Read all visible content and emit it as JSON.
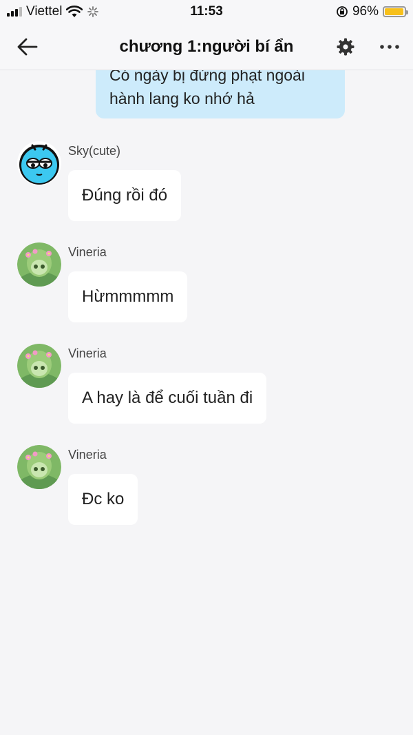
{
  "status_bar": {
    "carrier": "Viettel",
    "time": "11:53",
    "battery_percent": "96%",
    "battery_level": 0.96,
    "icons": [
      "signal-icon",
      "wifi-icon",
      "loading-icon",
      "orientation-lock-icon",
      "battery-icon"
    ]
  },
  "header": {
    "title": "chương 1:người bí ẩn",
    "icons": [
      "back-arrow-icon",
      "gear-icon",
      "more-icon"
    ]
  },
  "own_message": {
    "line1": "Có ngày bị đứng phạt ngoài",
    "line2": "hành lang ko nhớ hả"
  },
  "messages": [
    {
      "sender": "Sky(cute)",
      "text": "Đúng rồi đó",
      "avatar": "blue-cartoon-avatar"
    },
    {
      "sender": "Vineria",
      "text": "Hừmmmmm",
      "avatar": "green-girl-avatar"
    },
    {
      "sender": "Vineria",
      "text": "A hay là để cuối tuần đi",
      "avatar": "green-girl-avatar"
    },
    {
      "sender": "Vineria",
      "text": "Đc ko",
      "avatar": "green-girl-avatar"
    }
  ],
  "colors": {
    "background": "#f5f5f7",
    "own_bubble": "#cdebfb",
    "other_bubble": "#ffffff",
    "battery": "#f7c01b",
    "sky_avatar": "#3cc8f0",
    "vineria_avatar": "#9ccc7a"
  }
}
